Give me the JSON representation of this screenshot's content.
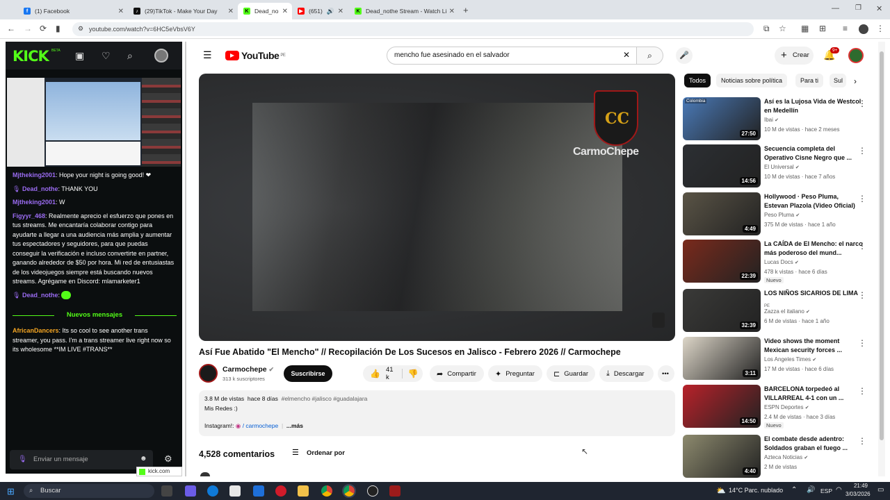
{
  "tabs": [
    {
      "label": "(1) Facebook",
      "color": "#1877f2"
    },
    {
      "label": "(29)TikTok - Make Your Day",
      "color": "#111"
    },
    {
      "label": "Dead_no",
      "color": "#53fc18"
    },
    {
      "label": "(651)",
      "color": "#ff0000"
    },
    {
      "label": "Dead_nothe Stream - Watch Li",
      "color": "#53fc18"
    }
  ],
  "url": "youtube.com/watch?v=6HC5eVbsV6Y",
  "kick": {
    "logo": "KICK",
    "beta": "BETA",
    "messages": [
      {
        "user": "Mjtheking2001",
        "color": "#9b6cf2",
        "text": ": Hope your night is going good! ❤",
        "badge": false
      },
      {
        "user": "Dead_nothe",
        "color": "#9b6cf2",
        "text": ": THANK YOU",
        "badge": true
      },
      {
        "user": "Mjtheking2001",
        "color": "#9b6cf2",
        "text": ": W",
        "badge": false
      },
      {
        "user": "Figyyr_468",
        "color": "#9b6cf2",
        "text": ": Realmente aprecio el esfuerzo que pones en tus streams. Me encantaría colaborar contigo para ayudarte a llegar a una audiencia más amplia y aumentar tus espectadores y seguidores, para que puedas conseguir la verificación e incluso convertirte en partner, ganando alrededor de $50 por hora. Mi red de entusiastas de los videojuegos siempre está buscando nuevos streams. Agrégame en Discord: mlamarketer1",
        "badge": false
      },
      {
        "user": "Dead_nothe",
        "color": "#9b6cf2",
        "text": ": ",
        "badge": true
      }
    ],
    "new_messages": "Nuevos mensajes",
    "after_message": {
      "user": "AfricanDancers",
      "color": "#f5a623",
      "text": ": Its so cool to see another trans streamer, you pass. I'm a trans streamer live right now so its wholesome **IM LIVE #TRANS**"
    },
    "input_placeholder": "Enviar un mensaje",
    "footer_label": "kick.com"
  },
  "youtube": {
    "logo": "YouTube",
    "logo_country": "PE",
    "search_value": "mencho fue asesinado en el salvador",
    "create_label": "Crear",
    "notif_count": "9+",
    "video_watermark": "CarmoChepe",
    "video_title": "Así Fue Abatido \"El Mencho\" // Recopilación De Los Sucesos en Jalisco - Febrero 2026 // Carmochepe",
    "channel": "Carmochepe",
    "subscribers": "313 k suscriptores",
    "subscribe_label": "Suscribirse",
    "likes": "41 k",
    "share_label": "Compartir",
    "ask_label": "Preguntar",
    "save_label": "Guardar",
    "download_label": "Descargar",
    "views": "3.8 M de vistas",
    "ago": "hace 8 días",
    "hashtags": "#elmencho #jalisco #guadalajara",
    "desc_line1": "Mis Redes :)",
    "desc_line2_prefix": "Instagram!:",
    "desc_link": "/ carmochepe",
    "more_label": "...más",
    "comments_count": "4,528 comentarios",
    "sort_label": "Ordenar por",
    "chips": [
      "Todos",
      "Noticias sobre política",
      "Para ti",
      "Sul"
    ],
    "recs": [
      {
        "title": "Así es la Lujosa Vida de Westcol en Medellín",
        "channel": "Ibai",
        "meta": "10 M de vistas · hace 2 meses",
        "dur": "27:50",
        "nuevo": "",
        "tag": "Colombia",
        "bg": "#4a7ab8"
      },
      {
        "title": "Secuencia completa del Operativo Cisne Negro que ...",
        "channel": "El Universal",
        "meta": "10 M de vistas · hace 7 años",
        "dur": "14:56",
        "nuevo": "",
        "tag": "",
        "bg": "#2c2f33"
      },
      {
        "title": "Hollywood · Peso Pluma, Estevan Plazola (Video Oficial)",
        "channel": "Peso Pluma",
        "meta": "375 M de vistas · hace 1 año",
        "dur": "4:49",
        "nuevo": "",
        "tag": "",
        "bg": "#5a5446"
      },
      {
        "title": "La CAÍDA de El Mencho: el narco más poderoso del mund...",
        "channel": "Lucas Docs",
        "meta": "478 k vistas · hace 6 días",
        "dur": "22:39",
        "nuevo": "Nuevo",
        "tag": "",
        "bg": "#7a2a1c"
      },
      {
        "title": "LOS NIÑOS SICARIOS DE LIMA",
        "channel": "Zazza el italiano",
        "meta": "6 M de vistas · hace 1 año",
        "dur": "32:39",
        "nuevo": "",
        "tag": "",
        "bg": "#3a3a38",
        "channel_prefix": "PE"
      },
      {
        "title": "Video shows the moment Mexican security forces ...",
        "channel": "Los Angeles Times",
        "meta": "17 M de vistas · hace 6 días",
        "dur": "3:11",
        "nuevo": "",
        "tag": "",
        "bg": "#ddd6c8"
      },
      {
        "title": "BARCELONA torpedeó al VILLARREAL 4-1 con un ...",
        "channel": "ESPN Deportes",
        "meta": "2.4 M de vistas · hace 3 días",
        "dur": "14:50",
        "nuevo": "Nuevo",
        "tag": "",
        "bg": "#b8222a"
      },
      {
        "title": "El combate desde adentro: Soldados graban el fuego ...",
        "channel": "Azteca Noticias",
        "meta": "2 M de vistas",
        "dur": "4:40",
        "nuevo": "",
        "tag": "",
        "bg": "#8d8a6e"
      }
    ]
  },
  "taskbar": {
    "search": "Buscar",
    "weather": "14°C  Parc. nublado",
    "lang": "ESP",
    "time": "21:49",
    "date": "3/03/2026"
  }
}
